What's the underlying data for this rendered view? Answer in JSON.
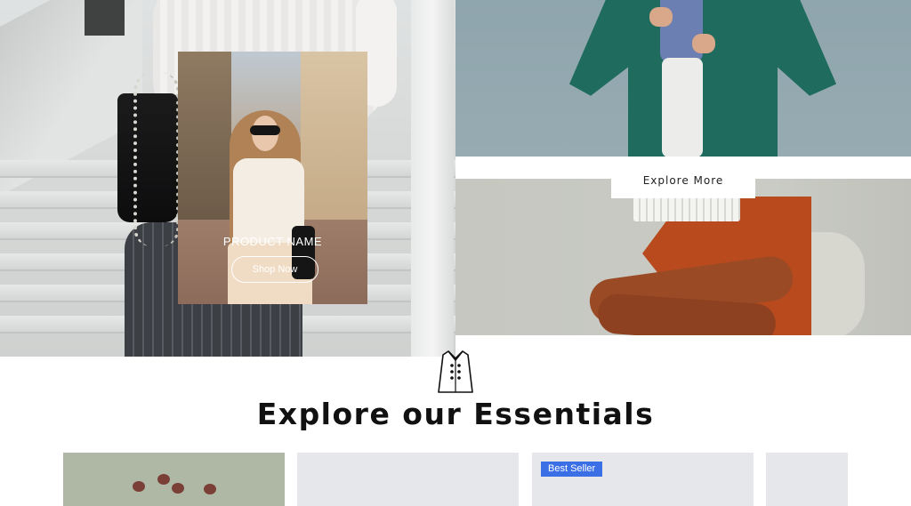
{
  "product_card": {
    "title": "PRODUCT NAME",
    "button_label": "Shop Now"
  },
  "hero": {
    "explore_button_label": "Explore More"
  },
  "section": {
    "title": "Explore our Essentials",
    "icon": "coat-icon"
  },
  "products": {
    "badge_label": "Best Seller",
    "badge_color": "#3b6fe6"
  }
}
